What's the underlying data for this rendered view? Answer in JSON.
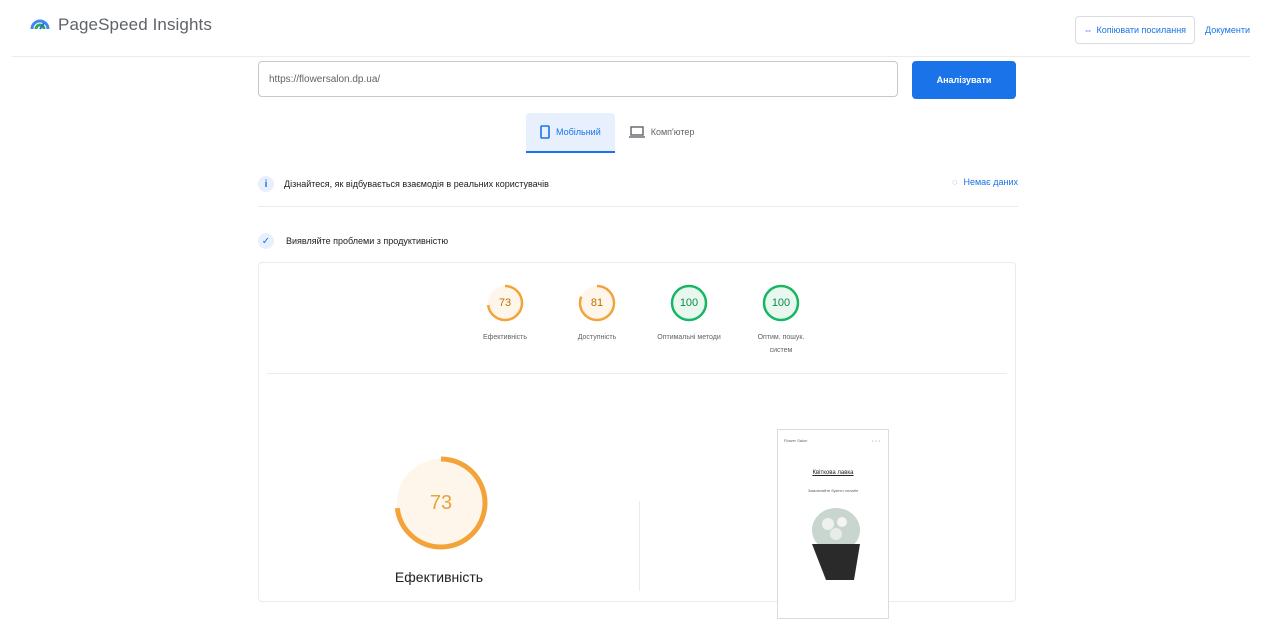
{
  "app": {
    "name": "PageSpeed Insights",
    "copy_link_label": "Копіювати посилання",
    "docs_label": "Документи"
  },
  "search": {
    "url_value": "https://flowersalon.dp.ua/",
    "analyze_label": "Аналізувати"
  },
  "tabs": [
    {
      "label": "Мобільний",
      "active": true
    },
    {
      "label": "Комп'ютер",
      "active": false
    }
  ],
  "field_data": {
    "text": "Дізнайтеся, як відбувається взаємодія в реальних користувачів",
    "no_data_label": "Немає даних"
  },
  "diagnose": {
    "text": "Виявляйте проблеми з продуктивністю"
  },
  "scores": [
    {
      "value": "73",
      "label": "Ефективність",
      "color": "#f2a33a"
    },
    {
      "value": "81",
      "label": "Доступність",
      "color": "#f2a33a"
    },
    {
      "value": "100",
      "label": "Оптимальні методи",
      "color": "#18b663"
    },
    {
      "value": "100",
      "label": "Оптим. пошук. систем",
      "color": "#18b663"
    }
  ],
  "performance": {
    "value": "73",
    "label": "Ефективність",
    "color": "#f2a33a"
  },
  "phone_preview": {
    "header": "Flower Salon",
    "title": "Квіткова лавка",
    "subtitle": "Замовляйте букети онлайн"
  }
}
